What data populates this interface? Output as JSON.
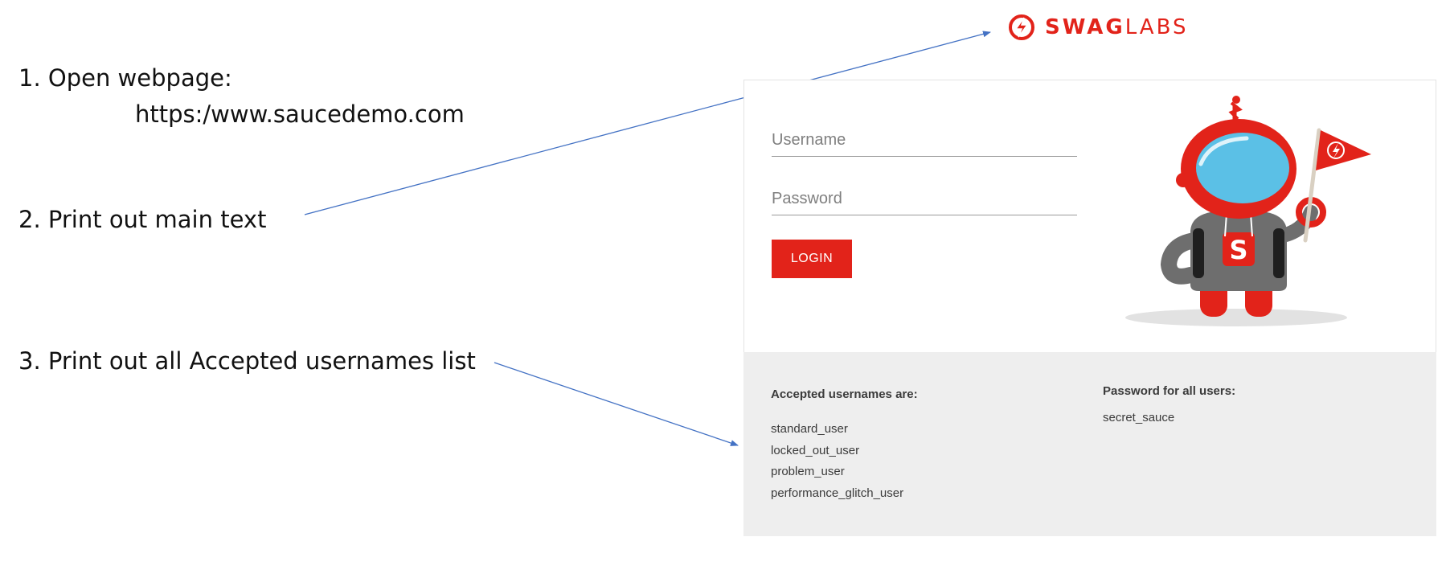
{
  "instructions": {
    "step1": "1. Open webpage:",
    "step1_url": "https:/www.saucedemo.com",
    "step2": "2. Print out main text",
    "step3": "3. Print out all Accepted usernames list"
  },
  "logo": {
    "text_bold": "SWAG",
    "text_light": "LABS",
    "icon": "swag-labs-bolt-icon"
  },
  "login": {
    "username_placeholder": "Username",
    "username_value": "",
    "password_placeholder": "Password",
    "password_value": "",
    "button_label": "LOGIN"
  },
  "credentials": {
    "usernames_heading": "Accepted usernames are:",
    "usernames": [
      "standard_user",
      "locked_out_user",
      "problem_user",
      "performance_glitch_user"
    ],
    "password_heading": "Password for all users:",
    "password": "secret_sauce"
  },
  "colors": {
    "brand_red": "#e2231a",
    "arrow_blue": "#4472c4",
    "panel_gray": "#eeeeee"
  }
}
